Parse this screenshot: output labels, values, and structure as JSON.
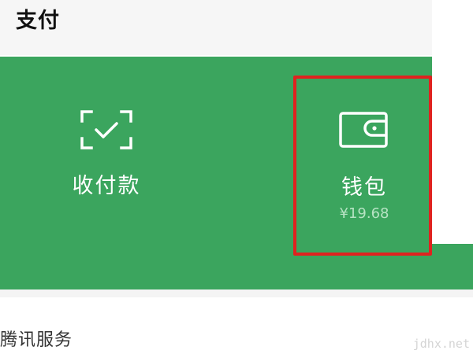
{
  "header": {
    "title": "支付"
  },
  "tiles": [
    {
      "label": "收付款",
      "icon": "scan-check-icon"
    },
    {
      "label": "钱包",
      "balance": "¥19.68",
      "icon": "wallet-icon"
    }
  ],
  "section": {
    "title": "腾讯服务"
  },
  "watermark": "jdhx.net",
  "colors": {
    "panel_green": "#3ba55e",
    "highlight_red": "#e0221f",
    "balance_text": "#b6e3c3"
  }
}
